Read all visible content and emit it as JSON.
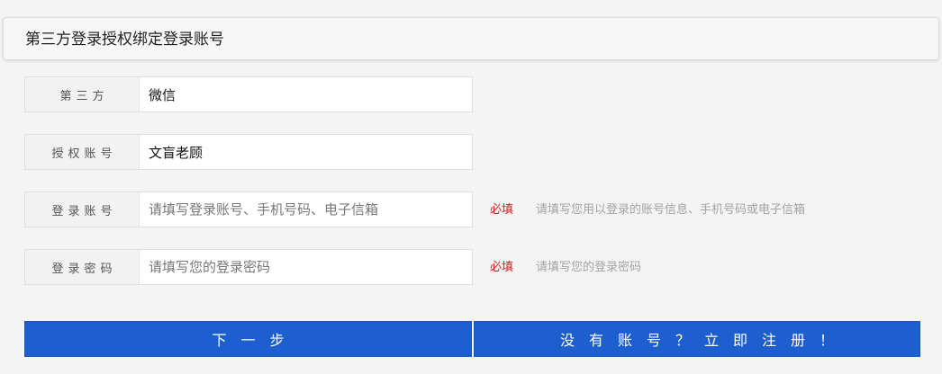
{
  "header": {
    "title": "第三方登录授权绑定登录账号"
  },
  "form": {
    "third_party": {
      "label": "第三方",
      "value": "微信"
    },
    "auth_account": {
      "label": "授权账号",
      "value": "文盲老顾"
    },
    "login_account": {
      "label": "登录账号",
      "placeholder": "请填写登录账号、手机号码、电子信箱",
      "required": "必填",
      "hint": "请填写您用以登录的账号信息、手机号码或电子信箱"
    },
    "login_password": {
      "label": "登录密码",
      "placeholder": "请填写您的登录密码",
      "required": "必填",
      "hint": "请填写您的登录密码"
    }
  },
  "buttons": {
    "next_label": "下一步",
    "register_label": "没有账号？立即注册！"
  },
  "colors": {
    "primary_button": "#1e5fcf",
    "required_text": "#d21b1b",
    "hint_text": "#a3a3a3"
  }
}
